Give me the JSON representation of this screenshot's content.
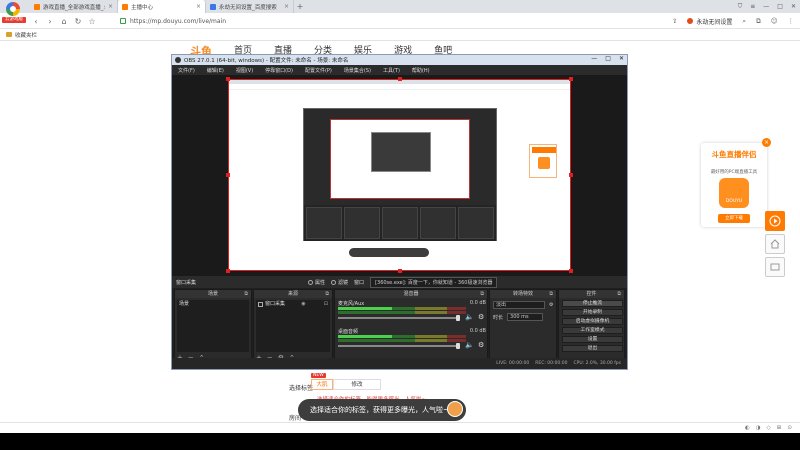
{
  "browser": {
    "badge": "云游戏版",
    "tabs": [
      {
        "title": "游戏直播_全部游戏直播_斗鱼",
        "color": "#ff7a00",
        "active": false
      },
      {
        "title": "主播中心",
        "color": "#ff7a00",
        "active": true
      },
      {
        "title": "永劫无间设置_百度搜索",
        "color": "#3b78e7",
        "active": false
      }
    ],
    "newtab": "+",
    "address": "https://mp.douyu.com/live/main",
    "plugin_label": "永劫无间设置",
    "bookmark_folder": "收藏夹栏"
  },
  "page": {
    "logo": "斗鱼",
    "nav": [
      "首页",
      "直播",
      "分类",
      "娱乐",
      "游戏",
      "鱼吧"
    ],
    "bottom": {
      "label_tags": "选择标签",
      "new_badge": "NEW",
      "tab_1": "大肌",
      "tab_2": "修改",
      "hint": "选择适合你的标签，能得更多曝光，人气啦~",
      "label_2": "房间"
    },
    "danmu": "选择适合你的标签，获得更多曝光，人气啦~"
  },
  "ad": {
    "close": "×",
    "title": "斗鱼直播伴侣",
    "desc": "最好用的PC端直播工具",
    "logo_text": "DOUYU",
    "button": "立即下载"
  },
  "obs": {
    "title": "OBS 27.0.1 (64-bit, windows) - 配置文件: 未命名 - 场景: 未命名",
    "menu": [
      "文件(F)",
      "编辑(E)",
      "视图(V)",
      "停靠窗口(D)",
      "配置文件(P)",
      "场景集合(S)",
      "工具(T)",
      "帮助(H)"
    ],
    "scene_bar": {
      "current": "窗口采集",
      "props": "属性",
      "filters": "滤镜",
      "window_label": "窗口",
      "window_value": "[360se.exe]: 百度一下，你就知道 - 360极速浏览器"
    },
    "docks": {
      "scenes": {
        "title": "场景",
        "items": [
          "场景"
        ]
      },
      "sources": {
        "title": "来源",
        "items": [
          "窗口采集"
        ]
      },
      "mixer": {
        "title": "混音器",
        "channels": [
          {
            "name": "麦克风/Aux",
            "db": "0.0 dB"
          },
          {
            "name": "桌面音频",
            "db": "0.0 dB"
          }
        ]
      },
      "transitions": {
        "title": "转场特效",
        "type": "淡出",
        "duration_label": "时长",
        "duration": "300 ms"
      },
      "controls": {
        "title": "控件",
        "buttons": [
          "停止推流",
          "开始录制",
          "启动虚拟摄像机",
          "工作室模式",
          "设置",
          "退出"
        ]
      }
    },
    "status": [
      "LIVE: 00:00:00",
      "REC: 00:00:00",
      "CPU: 2.0%, 30.00 fps"
    ]
  }
}
